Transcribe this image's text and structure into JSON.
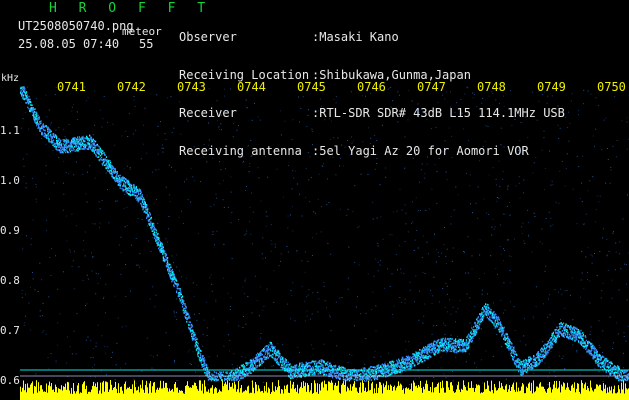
{
  "header": {
    "title": "H R O F F T",
    "file_name": "UT2508050740.png",
    "meteor_label": "meteor",
    "datetime": "25.08.05 07:40",
    "meteor_count": "55"
  },
  "info": [
    {
      "label": "Observer",
      "value": ":Masaki Kano"
    },
    {
      "label": "Receiving Location",
      "value": ":Shibukawa,Gunma,Japan"
    },
    {
      "label": "Receiver",
      "value": ":RTL-SDR SDR# 43dB L15 114.1MHz USB"
    },
    {
      "label": "Receiving antenna",
      "value": ":5el Yagi Az 20 for Aomori VOR"
    }
  ],
  "axis": {
    "unit": "kHz",
    "y_ticks": [
      "1.1",
      "1.0",
      "0.9",
      "0.8",
      "0.7",
      "0.6"
    ],
    "time_ticks": [
      "0741",
      "0742",
      "0743",
      "0744",
      "0745",
      "0746",
      "0747",
      "0748",
      "0749",
      "0750"
    ]
  },
  "colors": {
    "background": "#000000",
    "signal": "#3a8cff",
    "trace": "#00ffff",
    "noise_bar": "#ffff00",
    "title": "#19d23a"
  }
}
